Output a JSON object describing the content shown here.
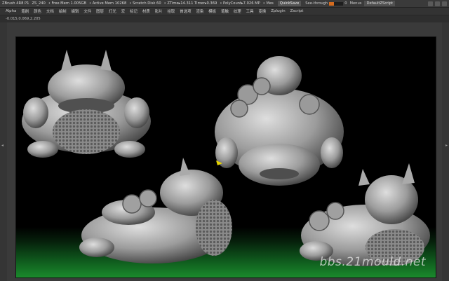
{
  "titlebar": {
    "app": "ZBrush 4R8 P1",
    "doc": "ZS_240",
    "free_mem": "• Free Mem 1.005GB",
    "active_mem": "• Active Mem 10268",
    "scratch": "• Scratch Disk 60",
    "ztime": "• ZTime▸14.311 Timer▸0.369",
    "polycount": "• PolyCount▸7.026 MP",
    "mesh": "• Mes",
    "quicksave": "QuickSave",
    "see_through_label": "See-through",
    "see_through_value": "0",
    "see_through_level": 0.35,
    "menus": "Menus",
    "default_script": "DefaultZScript"
  },
  "menubar": {
    "items": [
      "Alpha",
      "笔刷",
      "颜色",
      "文档",
      "绘制",
      "编辑",
      "文件",
      "图层",
      "灯光",
      "宏",
      "标记",
      "材质",
      "影片",
      "拾取",
      "首选项",
      "渲染",
      "模板",
      "笔触",
      "纹理",
      "工具",
      "变换",
      "Zplugin",
      "Zscript"
    ]
  },
  "status": {
    "text": "-0.015,0.069,2.205"
  },
  "colors": {
    "accent": "#d56b1e",
    "model": "#b9b9b9",
    "floor": "#1a8a2c"
  },
  "icons": {
    "left_tray": "chevron-left-icon",
    "right_tray": "chevron-right-icon"
  },
  "watermark": "bbs.21mould.net"
}
